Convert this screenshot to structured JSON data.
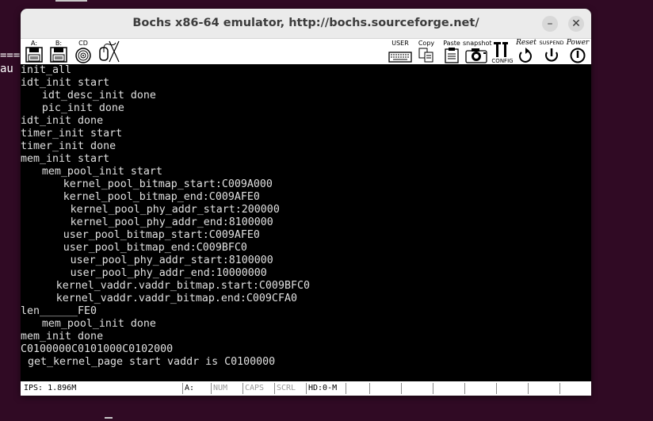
{
  "background_terminal": {
    "lines": [
      "===",
      "au"
    ]
  },
  "window": {
    "title": "Bochs x86-64 emulator, http://bochs.sourceforge.net/",
    "minimize_symbol": "–",
    "close_symbol": "✕"
  },
  "toolbar": {
    "left_items": [
      {
        "label": "A:",
        "icon": "floppy-a-icon"
      },
      {
        "label": "B:",
        "icon": "floppy-b-icon"
      },
      {
        "label": "CD",
        "icon": "cdrom-icon"
      },
      {
        "label": "",
        "icon": "mouse-icon"
      }
    ],
    "right_items": [
      {
        "label": "USER",
        "icon": "keyboard-icon"
      },
      {
        "label": "Copy",
        "icon": "copy-icon"
      },
      {
        "label": "Paste",
        "icon": "paste-icon"
      },
      {
        "label": "snapshot",
        "icon": "camera-icon"
      },
      {
        "label": "CONFIG",
        "icon": "config-icon"
      },
      {
        "label": "Reset",
        "icon": "reset-icon"
      },
      {
        "label": "SUSPEND",
        "icon": "suspend-icon"
      },
      {
        "label": "Power",
        "icon": "power-icon"
      }
    ]
  },
  "screen": {
    "lines": [
      {
        "text": "init_all",
        "indent": 0
      },
      {
        "text": "idt_init start",
        "indent": 0
      },
      {
        "text": "idt_desc_init done",
        "indent": 3
      },
      {
        "text": "pic_init done",
        "indent": 3
      },
      {
        "text": "idt_init done",
        "indent": 0
      },
      {
        "text": "timer_init start",
        "indent": 0
      },
      {
        "text": "timer_init done",
        "indent": 0
      },
      {
        "text": "mem_init start",
        "indent": 0
      },
      {
        "text": "mem_pool_init start",
        "indent": 3
      },
      {
        "text": "kernel_pool_bitmap_start:C009A000",
        "indent": 6
      },
      {
        "text": "kernel_pool_bitmap_end:C009AFE0",
        "indent": 6
      },
      {
        "text": "kernel_pool_phy_addr_start:200000",
        "indent": 7
      },
      {
        "text": "kernel_pool_phy_addr_end:8100000",
        "indent": 7
      },
      {
        "text": "user_pool_bitmap_start:C009AFE0",
        "indent": 6
      },
      {
        "text": "user_pool_bitmap_end:C009BFC0",
        "indent": 6
      },
      {
        "text": "user_pool_phy_addr_start:8100000",
        "indent": 7
      },
      {
        "text": "user_pool_phy_addr_end:10000000",
        "indent": 7
      },
      {
        "text": "kernel_vaddr.vaddr_bitmap.start:C009BFC0",
        "indent": 5
      },
      {
        "text": "kernel_vaddr.vaddr_bitmap.end:C009CFA0",
        "indent": 5
      },
      {
        "text": "len______FE0",
        "indent": 0
      },
      {
        "text": "mem_pool_init done",
        "indent": 3
      },
      {
        "text": "mem_init done",
        "indent": 0
      },
      {
        "text": "C0100000C0101000C0102000",
        "indent": 0
      },
      {
        "text": "get_kernel_page start vaddr is C0100000",
        "indent": 1
      }
    ]
  },
  "statusbar": {
    "ips": "IPS: 1.896M",
    "drive": "A:",
    "num": "NUM",
    "caps": "CAPS",
    "scrl": "SCRL",
    "hd": "HD:0-M"
  }
}
